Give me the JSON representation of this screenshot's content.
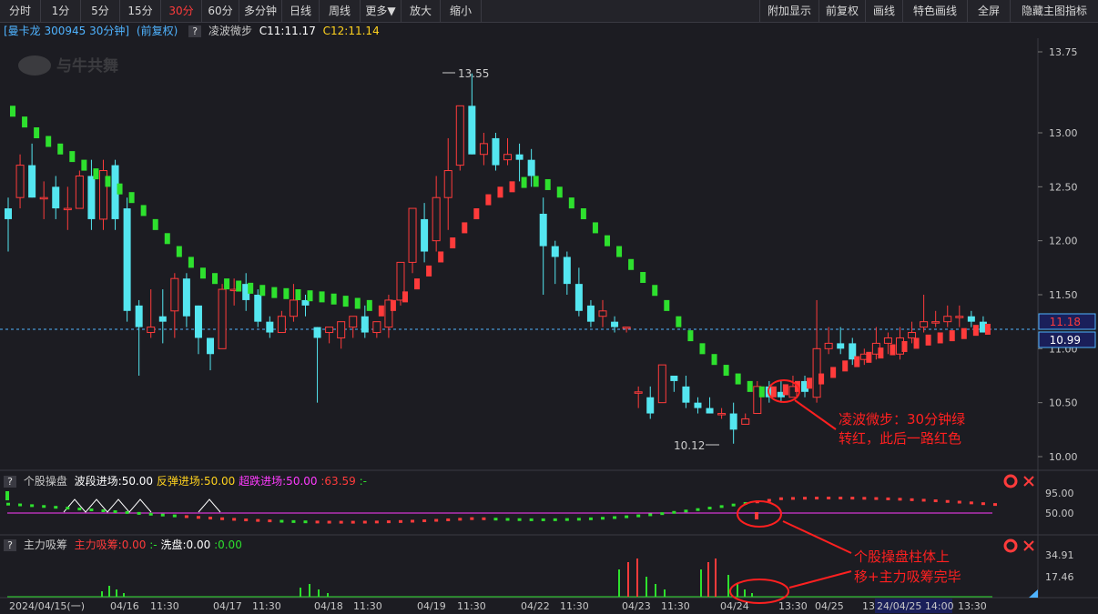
{
  "toolbar": {
    "left_tabs": [
      "分时",
      "1分",
      "5分",
      "15分",
      "30分",
      "60分",
      "多分钟",
      "日线",
      "周线",
      "更多▼",
      "放大",
      "缩小"
    ],
    "active": "30分",
    "right_tabs": [
      "附加显示",
      "前复权",
      "画线",
      "特色画线",
      "全屏",
      "隐藏主图指标"
    ]
  },
  "header": {
    "stock": "[曼卡龙 300945 30分钟]",
    "adjust": "(前复权)",
    "q": "?",
    "indicator": "凌波微步",
    "c11": "C11:11.17",
    "c12": "C12:11.14"
  },
  "watermark": "与牛共舞",
  "price_axis": [
    "13.75",
    "13.00",
    "12.50",
    "12.00",
    "11.50",
    "11.00",
    "10.50",
    "10.00"
  ],
  "price_tags": {
    "current": "11.18",
    "line": "10.99"
  },
  "annotations": {
    "high": "13.55",
    "low": "10.12",
    "main_note_line1": "凌波微步：30分钟绿",
    "main_note_line2": "转红，此后一路红色",
    "sub_note_line1": "个股操盘柱体上",
    "sub_note_line2": "移+主力吸筹完毕"
  },
  "panel1": {
    "q": "?",
    "name": "个股操盘",
    "l1": "波段进场:50.00",
    "l2": "反弹进场:50.00",
    "l3": "超跌进场:50.00",
    "l4": ":63.59",
    "l5": ":-",
    "axis": [
      "95.00",
      "50.00"
    ]
  },
  "panel2": {
    "q": "?",
    "name": "主力吸筹",
    "l1": "主力吸筹:0.00",
    "l2": ":-",
    "l3": "洗盘:0.00",
    "l4": ":0.00",
    "axis": [
      "34.91",
      "17.46"
    ]
  },
  "time_axis": [
    "2024/04/15(一)",
    "04/16",
    "11:30",
    "04/17",
    "11:30",
    "04/18",
    "11:30",
    "04/19",
    "11:30",
    "04/22",
    "11:30",
    "04/23",
    "11:30",
    "04/24",
    "13:30",
    "04/25",
    "13:",
    "24/04/25 14:00",
    "13:30"
  ],
  "colors": {
    "up": "#ff3b3b",
    "down": "#54e6f0",
    "green": "#2ee02e",
    "magenta": "#ff3bff",
    "yellow": "#ffd21e"
  },
  "candles": [
    [
      12.3,
      12.4,
      12.2,
      11.9
    ],
    [
      12.4,
      12.8,
      12.7,
      12.3
    ],
    [
      12.7,
      12.9,
      12.4,
      12.4
    ],
    [
      12.4,
      12.55,
      12.4,
      12.2
    ],
    [
      12.5,
      12.6,
      12.3,
      12.2
    ],
    [
      12.3,
      12.5,
      12.3,
      12.1
    ],
    [
      12.3,
      12.65,
      12.6,
      12.3
    ],
    [
      12.6,
      12.75,
      12.2,
      12.1
    ],
    [
      12.2,
      12.75,
      12.65,
      12.1
    ],
    [
      12.7,
      12.75,
      12.2,
      12.1
    ],
    [
      12.3,
      12.4,
      11.35,
      11.25
    ],
    [
      11.4,
      11.45,
      11.2,
      10.75
    ],
    [
      11.15,
      11.55,
      11.2,
      11.1
    ],
    [
      11.3,
      11.55,
      11.25,
      11.05
    ],
    [
      11.35,
      11.7,
      11.65,
      11.1
    ],
    [
      11.65,
      11.7,
      11.3,
      11.2
    ],
    [
      11.4,
      11.4,
      11.1,
      10.95
    ],
    [
      11.1,
      11.1,
      10.95,
      10.8
    ],
    [
      11.0,
      11.6,
      11.55,
      11.0
    ],
    [
      11.55,
      11.65,
      11.55,
      11.4
    ],
    [
      11.6,
      11.7,
      11.45,
      11.35
    ],
    [
      11.5,
      11.55,
      11.25,
      11.2
    ],
    [
      11.25,
      11.3,
      11.15,
      11.1
    ],
    [
      11.15,
      11.35,
      11.3,
      11.15
    ],
    [
      11.3,
      11.6,
      11.45,
      11.25
    ],
    [
      11.45,
      11.5,
      11.4,
      11.3
    ],
    [
      11.2,
      11.2,
      11.1,
      10.5
    ],
    [
      11.15,
      11.2,
      11.2,
      11.05
    ],
    [
      11.1,
      11.2,
      11.25,
      11.0
    ],
    [
      11.2,
      11.25,
      11.3,
      11.1
    ],
    [
      11.3,
      11.4,
      11.15,
      11.1
    ],
    [
      11.15,
      11.25,
      11.25,
      11.1
    ],
    [
      11.2,
      11.5,
      11.45,
      11.1
    ],
    [
      11.45,
      11.75,
      11.8,
      11.4
    ],
    [
      11.8,
      12.25,
      12.3,
      11.7
    ],
    [
      12.2,
      12.35,
      11.9,
      11.8
    ],
    [
      12.0,
      12.6,
      12.4,
      11.9
    ],
    [
      12.4,
      12.95,
      12.65,
      12.1
    ],
    [
      12.7,
      13.2,
      13.25,
      12.65
    ],
    [
      13.25,
      13.55,
      12.8,
      12.8
    ],
    [
      12.8,
      13.0,
      12.9,
      12.7
    ],
    [
      12.95,
      13.0,
      12.7,
      12.65
    ],
    [
      12.75,
      12.95,
      12.8,
      12.7
    ],
    [
      12.8,
      12.9,
      12.75,
      12.55
    ],
    [
      12.75,
      12.85,
      12.6,
      12.5
    ],
    [
      12.25,
      12.4,
      11.95,
      11.5
    ],
    [
      11.95,
      12.0,
      11.85,
      11.6
    ],
    [
      11.85,
      11.9,
      11.6,
      11.5
    ],
    [
      11.6,
      11.75,
      11.35,
      11.3
    ],
    [
      11.4,
      11.45,
      11.25,
      11.2
    ],
    [
      11.3,
      11.45,
      11.35,
      11.2
    ],
    [
      11.25,
      11.3,
      11.2,
      11.15
    ],
    [
      11.2,
      11.2,
      11.2,
      11.15
    ],
    [
      10.6,
      10.65,
      10.6,
      10.45
    ],
    [
      10.55,
      10.65,
      10.4,
      10.35
    ],
    [
      10.5,
      10.8,
      10.85,
      10.5
    ],
    [
      10.75,
      10.75,
      10.7,
      10.6
    ],
    [
      10.65,
      10.75,
      10.5,
      10.45
    ],
    [
      10.5,
      10.55,
      10.45,
      10.4
    ],
    [
      10.45,
      10.55,
      10.4,
      10.4
    ],
    [
      10.4,
      10.45,
      10.4,
      10.35
    ],
    [
      10.4,
      10.5,
      10.25,
      10.12
    ],
    [
      10.3,
      10.4,
      10.35,
      10.3
    ],
    [
      10.4,
      10.7,
      10.65,
      10.4
    ],
    [
      10.65,
      10.7,
      10.55,
      10.5
    ],
    [
      10.6,
      10.7,
      10.55,
      10.5
    ],
    [
      10.55,
      10.75,
      10.65,
      10.55
    ],
    [
      10.7,
      10.75,
      10.6,
      10.55
    ],
    [
      10.55,
      11.45,
      11.0,
      10.5
    ],
    [
      11.0,
      11.2,
      11.05,
      10.95
    ],
    [
      11.05,
      11.2,
      11.0,
      10.95
    ],
    [
      11.05,
      11.1,
      10.9,
      10.85
    ],
    [
      10.9,
      11.0,
      10.95,
      10.85
    ],
    [
      10.95,
      11.2,
      11.05,
      10.9
    ],
    [
      11.05,
      11.15,
      11.1,
      10.95
    ],
    [
      10.95,
      11.2,
      11.1,
      10.9
    ],
    [
      11.1,
      11.25,
      11.15,
      11.05
    ],
    [
      11.2,
      11.5,
      11.25,
      11.15
    ],
    [
      11.25,
      11.35,
      11.25,
      11.2
    ],
    [
      11.25,
      11.4,
      11.3,
      11.2
    ],
    [
      11.3,
      11.4,
      11.3,
      11.2
    ],
    [
      11.3,
      11.35,
      11.25,
      11.2
    ],
    [
      11.25,
      11.3,
      11.15,
      11.15
    ]
  ],
  "wave": [
    [
      13.2,
      "g"
    ],
    [
      13.1,
      "g"
    ],
    [
      13.0,
      "g"
    ],
    [
      12.92,
      "g"
    ],
    [
      12.85,
      "g"
    ],
    [
      12.78,
      "g"
    ],
    [
      12.7,
      "g"
    ],
    [
      12.62,
      "g"
    ],
    [
      12.55,
      "g"
    ],
    [
      12.48,
      "g"
    ],
    [
      12.4,
      "g"
    ],
    [
      12.28,
      "g"
    ],
    [
      12.15,
      "g"
    ],
    [
      12.02,
      "g"
    ],
    [
      11.9,
      "g"
    ],
    [
      11.8,
      "g"
    ],
    [
      11.7,
      "g"
    ],
    [
      11.65,
      "g"
    ],
    [
      11.6,
      "g"
    ],
    [
      11.58,
      "g"
    ],
    [
      11.56,
      "g"
    ],
    [
      11.54,
      "g"
    ],
    [
      11.52,
      "g"
    ],
    [
      11.51,
      "g"
    ],
    [
      11.5,
      "g"
    ],
    [
      11.49,
      "g"
    ],
    [
      11.48,
      "g"
    ],
    [
      11.46,
      "g"
    ],
    [
      11.44,
      "g"
    ],
    [
      11.42,
      "g"
    ],
    [
      11.4,
      "g"
    ],
    [
      11.35,
      "r"
    ],
    [
      11.4,
      "r"
    ],
    [
      11.48,
      "r"
    ],
    [
      11.6,
      "r"
    ],
    [
      11.72,
      "r"
    ],
    [
      11.85,
      "r"
    ],
    [
      11.98,
      "r"
    ],
    [
      12.12,
      "r"
    ],
    [
      12.25,
      "r"
    ],
    [
      12.38,
      "r"
    ],
    [
      12.45,
      "r"
    ],
    [
      12.5,
      "r"
    ],
    [
      12.54,
      "g"
    ],
    [
      12.55,
      "g"
    ],
    [
      12.52,
      "g"
    ],
    [
      12.45,
      "g"
    ],
    [
      12.35,
      "g"
    ],
    [
      12.25,
      "g"
    ],
    [
      12.12,
      "g"
    ],
    [
      12.0,
      "g"
    ],
    [
      11.9,
      "g"
    ],
    [
      11.78,
      "g"
    ],
    [
      11.66,
      "g"
    ],
    [
      11.54,
      "g"
    ],
    [
      11.4,
      "g"
    ],
    [
      11.25,
      "g"
    ],
    [
      11.12,
      "g"
    ],
    [
      11.0,
      "g"
    ],
    [
      10.9,
      "g"
    ],
    [
      10.8,
      "g"
    ],
    [
      10.72,
      "g"
    ],
    [
      10.65,
      "g"
    ],
    [
      10.6,
      "g"
    ],
    [
      10.6,
      "r"
    ],
    [
      10.62,
      "r"
    ],
    [
      10.65,
      "r"
    ],
    [
      10.68,
      "r"
    ],
    [
      10.72,
      "r"
    ],
    [
      10.78,
      "r"
    ],
    [
      10.84,
      "r"
    ],
    [
      10.88,
      "r"
    ],
    [
      10.92,
      "r"
    ],
    [
      10.96,
      "r"
    ],
    [
      10.99,
      "r"
    ],
    [
      11.02,
      "r"
    ],
    [
      11.05,
      "r"
    ],
    [
      11.08,
      "r"
    ],
    [
      11.1,
      "r"
    ],
    [
      11.12,
      "r"
    ],
    [
      11.14,
      "r"
    ],
    [
      11.17,
      "r"
    ],
    [
      11.18,
      "r"
    ]
  ]
}
